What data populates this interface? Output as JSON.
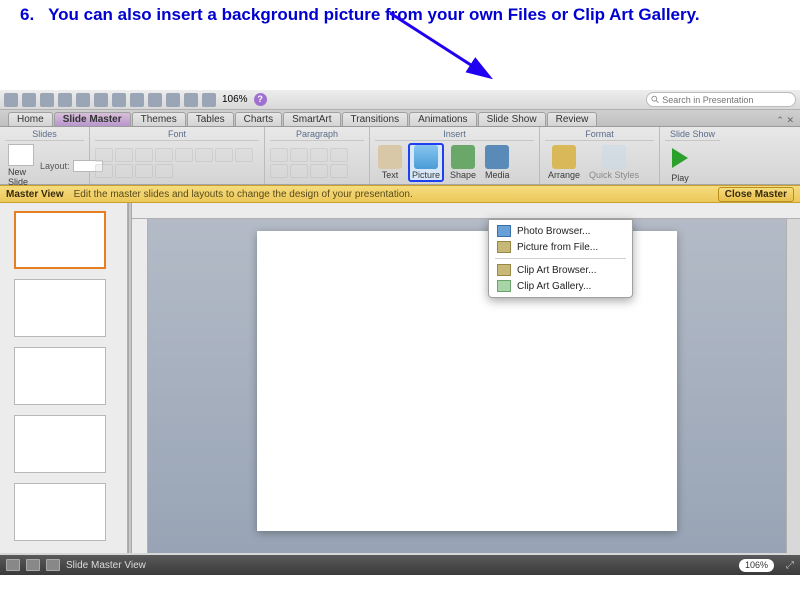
{
  "instruction": {
    "number": "6.",
    "text": "You can also insert a background picture from your own Files or Clip Art Gallery."
  },
  "toolbar": {
    "zoom": "106%",
    "search_placeholder": "Search in Presentation"
  },
  "tabs": [
    "Home",
    "Slide Master",
    "Themes",
    "Tables",
    "Charts",
    "SmartArt",
    "Transitions",
    "Animations",
    "Slide Show",
    "Review"
  ],
  "tabs_active_index": 1,
  "ribbon": {
    "groups": {
      "slides": {
        "title": "Slides",
        "new_slide": "New Slide",
        "layout": "Layout:"
      },
      "font": {
        "title": "Font"
      },
      "paragraph": {
        "title": "Paragraph"
      },
      "insert": {
        "title": "Insert",
        "text": "Text",
        "picture": "Picture",
        "shape": "Shape",
        "media": "Media"
      },
      "format": {
        "title": "Format",
        "arrange": "Arrange",
        "quickstyles": "Quick Styles"
      },
      "slideshow": {
        "title": "Slide Show",
        "play": "Play"
      }
    }
  },
  "infobar": {
    "title": "Master View",
    "msg": "Edit the master slides and layouts to change the design of your presentation.",
    "close": "Close Master"
  },
  "dropdown": {
    "items": [
      "Photo Browser...",
      "Picture from File...",
      "Clip Art Browser...",
      "Clip Art Gallery..."
    ]
  },
  "status": {
    "view": "Slide Master View",
    "zoom": "106%"
  }
}
